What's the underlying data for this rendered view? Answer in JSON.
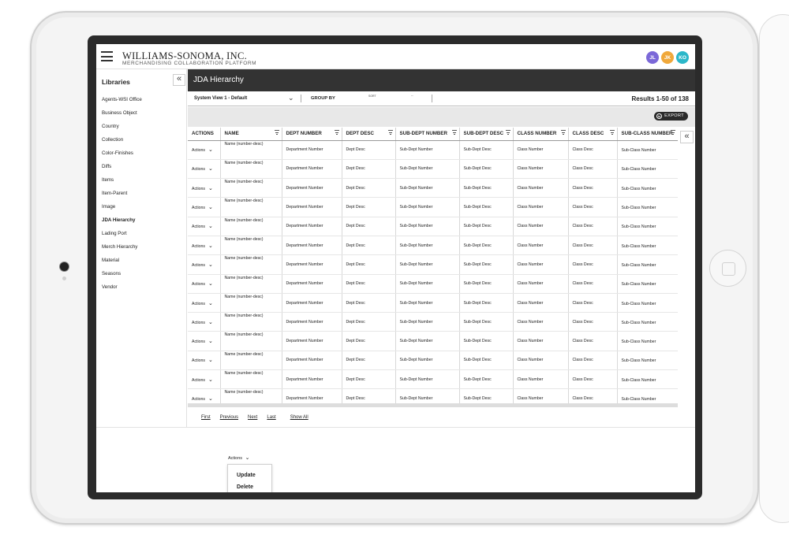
{
  "header": {
    "brand_name": "WILLIAMS-SONOMA, INC.",
    "brand_sub": "MERCHANDISING COLLABORATION PLATFORM",
    "avatars": [
      {
        "initials": "JL",
        "color": "#7b68d8"
      },
      {
        "initials": "JK",
        "color": "#f0a83a"
      },
      {
        "initials": "KO",
        "color": "#2bb7c9"
      }
    ]
  },
  "sidebar": {
    "title": "Libraries",
    "collapse_icon": "«",
    "items": [
      {
        "label": "Agents-WSI Office"
      },
      {
        "label": "Business Object"
      },
      {
        "label": "Country"
      },
      {
        "label": "Collection"
      },
      {
        "label": "Color-Finishes"
      },
      {
        "label": "Diffs"
      },
      {
        "label": "Items"
      },
      {
        "label": "Item-Parent"
      },
      {
        "label": "Image"
      },
      {
        "label": "JDA Hierarchy",
        "active": true
      },
      {
        "label": "Lading Port"
      },
      {
        "label": "Merch Hierarchy"
      },
      {
        "label": "Material"
      },
      {
        "label": "Seasons"
      },
      {
        "label": "Vendor"
      }
    ]
  },
  "main": {
    "title": "JDA Hierarchy",
    "view_select": "System View 1 - Default",
    "group_by": "GROUP BY",
    "sort_label": "SORT",
    "dash_label": "--",
    "results": "Results 1-50 of 138",
    "export_label": "EXPORT",
    "expand_icon": "«"
  },
  "table": {
    "columns": [
      "ACTIONS",
      "NAME",
      "DEPT NUMBER",
      "DEPT DESC",
      "SUB-DEPT NUMBER",
      "SUB-DEPT DESC",
      "CLASS NUMBER",
      "CLASS DESC",
      "SUB-CLASS NUMBER"
    ],
    "row_template": {
      "actions": "Actions",
      "name": "Name (number-desc)",
      "dept_number": "Department Number",
      "dept_desc": "Dept Desc",
      "sub_dept_number": "Sub-Dept Number",
      "sub_dept_desc": "Sub-Dept Desc",
      "class_number": "Class Number",
      "class_desc": "Class Desc",
      "sub_class_number": "Sub-Class Number"
    },
    "row_count": 14
  },
  "pagination": [
    "First",
    "Previous",
    "Next",
    "Last",
    "Show All"
  ],
  "actions_menu": {
    "trigger": "Actions",
    "items": [
      "Update",
      "Delete"
    ]
  }
}
